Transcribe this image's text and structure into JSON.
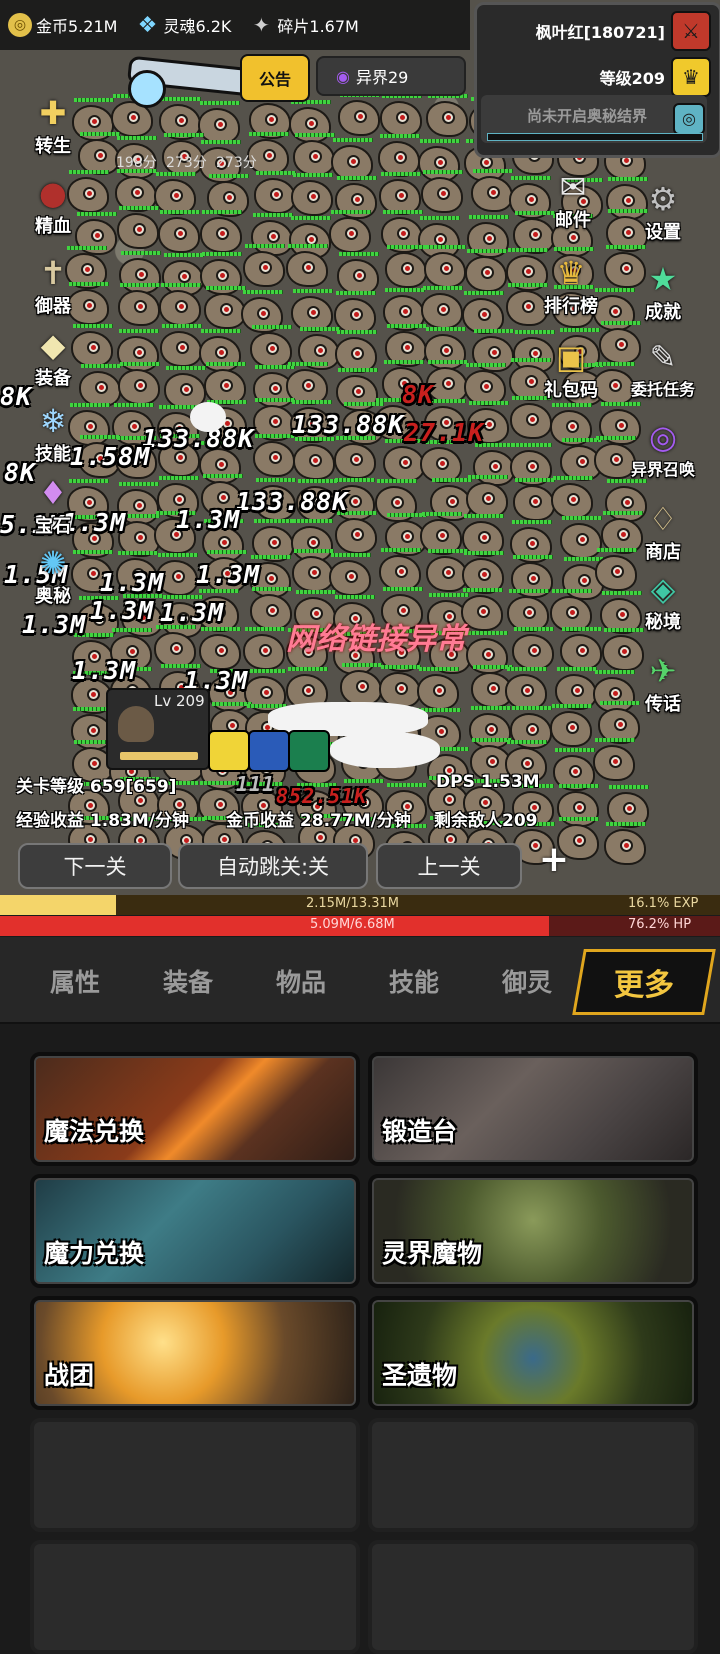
{
  "currency": [
    {
      "icon": "coin-icon",
      "label": "金币5.21M",
      "color": "#e2c04a"
    },
    {
      "icon": "soul-icon",
      "label": "灵魂6.2K",
      "color": "#7fd6ff"
    },
    {
      "icon": "shard-icon",
      "label": "碎片1.67M",
      "color": "#cfcfcf"
    }
  ],
  "player": {
    "name": "枫叶红[180721]",
    "level": "等级209",
    "realm": "尚未开启奥秘结界"
  },
  "notice": "公告",
  "otherworld": "异界29",
  "scores": [
    "198分",
    "273分",
    "273分"
  ],
  "left_menu": [
    {
      "name": "rebirth",
      "label": "转生",
      "icon": "✚",
      "color": "#f2d060"
    },
    {
      "name": "essence-blood",
      "label": "精血",
      "icon": "●",
      "color": "#b0302c"
    },
    {
      "name": "spirit-control",
      "label": "御器",
      "icon": "✝",
      "color": "#d8c9a0"
    },
    {
      "name": "equipment",
      "label": "装备",
      "icon": "◆",
      "color": "#f0e6b0"
    },
    {
      "name": "skills",
      "label": "技能",
      "icon": "❄",
      "color": "#9fd8ff"
    },
    {
      "name": "treasure",
      "label": "宝石",
      "icon": "♦",
      "color": "#d28cf0"
    },
    {
      "name": "mystery",
      "label": "奥秘",
      "icon": "✺",
      "color": "#63c7f5"
    }
  ],
  "right_menu": [
    {
      "name": "mail",
      "label": "邮件",
      "icon": "✉",
      "color": "#e8e8e8"
    },
    {
      "name": "settings",
      "label": "设置",
      "icon": "⚙",
      "color": "#c0c0c0"
    },
    {
      "name": "ranking",
      "label": "排行榜",
      "icon": "♛",
      "color": "#e7b93d"
    },
    {
      "name": "achievement",
      "label": "成就",
      "icon": "★",
      "color": "#4fdc9a"
    },
    {
      "name": "gift-code",
      "label": "礼包码",
      "icon": "▣",
      "color": "#eac34a"
    },
    {
      "name": "commission",
      "label": "委托任务",
      "icon": "✎",
      "color": "#dcdcdc"
    },
    {
      "name": "otherworld-summon",
      "label": "异界召唤",
      "icon": "◎",
      "color": "#a45bf0"
    },
    {
      "name": "shop",
      "label": "商店",
      "icon": "♢",
      "color": "#d9c48f"
    },
    {
      "name": "secret-realm",
      "label": "秘境",
      "icon": "◈",
      "color": "#3fc7a4"
    },
    {
      "name": "message",
      "label": "传话",
      "icon": "✈",
      "color": "#56d36a"
    }
  ],
  "damage_numbers": [
    "133.88K",
    "133.88K",
    "133.88K",
    "1.58M",
    "1.3M",
    "1.3M",
    "1.3M",
    "1.3M",
    "1.3M",
    "1.3M",
    "1.3M",
    "1.3M",
    "1.3M",
    "8K",
    "8K",
    "5.1K",
    "1.5M"
  ],
  "red_damage": [
    "8K",
    "27.1K"
  ],
  "error_text": "网络链接异常",
  "monster_level": "Lv 209",
  "battle_overlay": [
    "111",
    "852.51K"
  ],
  "stats": {
    "stage_level": "关卡等级 659[659]",
    "dps": "DPS 1.53M",
    "exp_income": "经验收益 1.83M/分钟",
    "gold_income": "金币收益 28.77M/分钟",
    "enemies_left": "剩余敌人209"
  },
  "nav": {
    "next": "下一关",
    "auto": "自动跳关:关",
    "prev": "上一关",
    "add": "+"
  },
  "exp_bar": {
    "text": "2.15M/13.31M",
    "percent": "16.1% EXP",
    "fraction": 0.161
  },
  "hp_bar": {
    "text": "5.09M/6.68M",
    "percent": "76.2%  HP",
    "fraction": 0.762
  },
  "tabs": [
    "属性",
    "装备",
    "物品",
    "技能",
    "御灵",
    "更多"
  ],
  "cards": [
    "魔法兑换",
    "锻造台",
    "魔力兑换",
    "灵界魔物",
    "战团",
    "圣遗物"
  ]
}
